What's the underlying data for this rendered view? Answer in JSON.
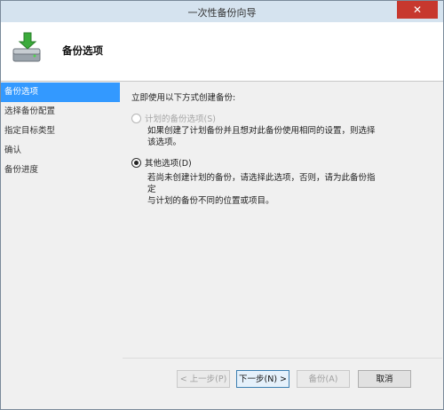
{
  "window": {
    "title": "一次性备份向导",
    "close_glyph": "✕"
  },
  "header": {
    "heading": "备份选项",
    "icon": "backup-drive-icon"
  },
  "nav": {
    "items": [
      {
        "label": "备份选项",
        "active": true
      },
      {
        "label": "选择备份配置",
        "active": false
      },
      {
        "label": "指定目标类型",
        "active": false
      },
      {
        "label": "确认",
        "active": false
      },
      {
        "label": "备份进度",
        "active": false
      }
    ]
  },
  "main": {
    "prompt": "立即使用以下方式创建备份:",
    "options": [
      {
        "label": "计划的备份选项(S)",
        "description_line1": "如果创建了计划备份并且想对此备份使用相同的设置，则选择",
        "description_line2": "该选项。",
        "selected": false,
        "enabled": false
      },
      {
        "label": "其他选项(D)",
        "description_line1": "若尚未创建计划的备份，请选择此选项，否则，请为此备份指定",
        "description_line2": "与计划的备份不同的位置或项目。",
        "selected": true,
        "enabled": true
      }
    ]
  },
  "buttons": {
    "back": "< 上一步(P)",
    "next": "下一步(N) >",
    "backup": "备份(A)",
    "cancel": "取消"
  },
  "colors": {
    "nav_active": "#3399ff",
    "close": "#c7382e",
    "titlebar": "#d5e3ef"
  }
}
